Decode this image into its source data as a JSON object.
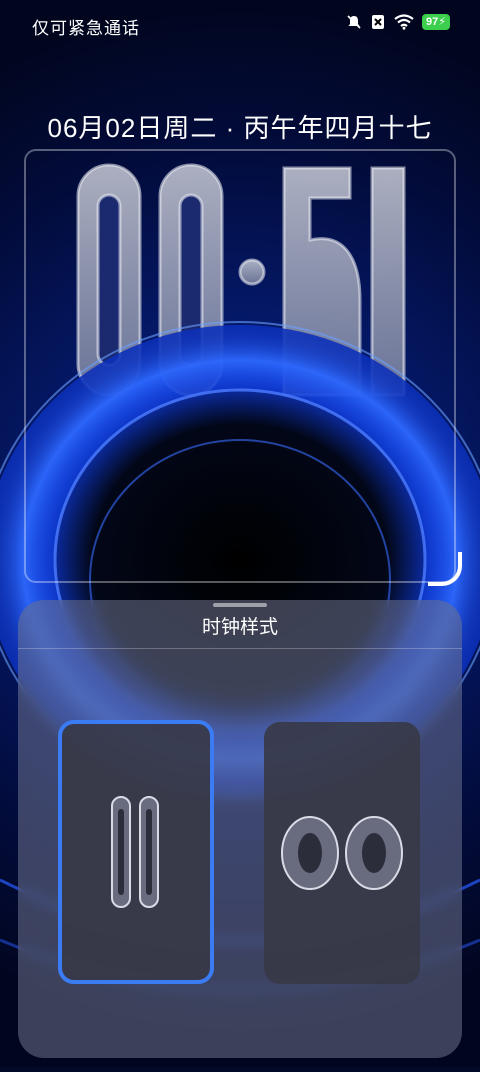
{
  "status_bar": {
    "carrier_text": "仅可紧急通话",
    "icons": [
      "mute-bell-icon",
      "no-sim-icon",
      "wifi-icon"
    ],
    "battery_level": "97"
  },
  "lockscreen": {
    "date_text": "06月02日周二 · 丙午年四月十七",
    "clock_time": "00:51"
  },
  "clock_style_sheet": {
    "title": "时钟样式",
    "options": [
      {
        "preview_text": "00",
        "selected": true
      },
      {
        "preview_text": "00",
        "selected": false
      }
    ],
    "accent_color": "#3b7cf5"
  }
}
